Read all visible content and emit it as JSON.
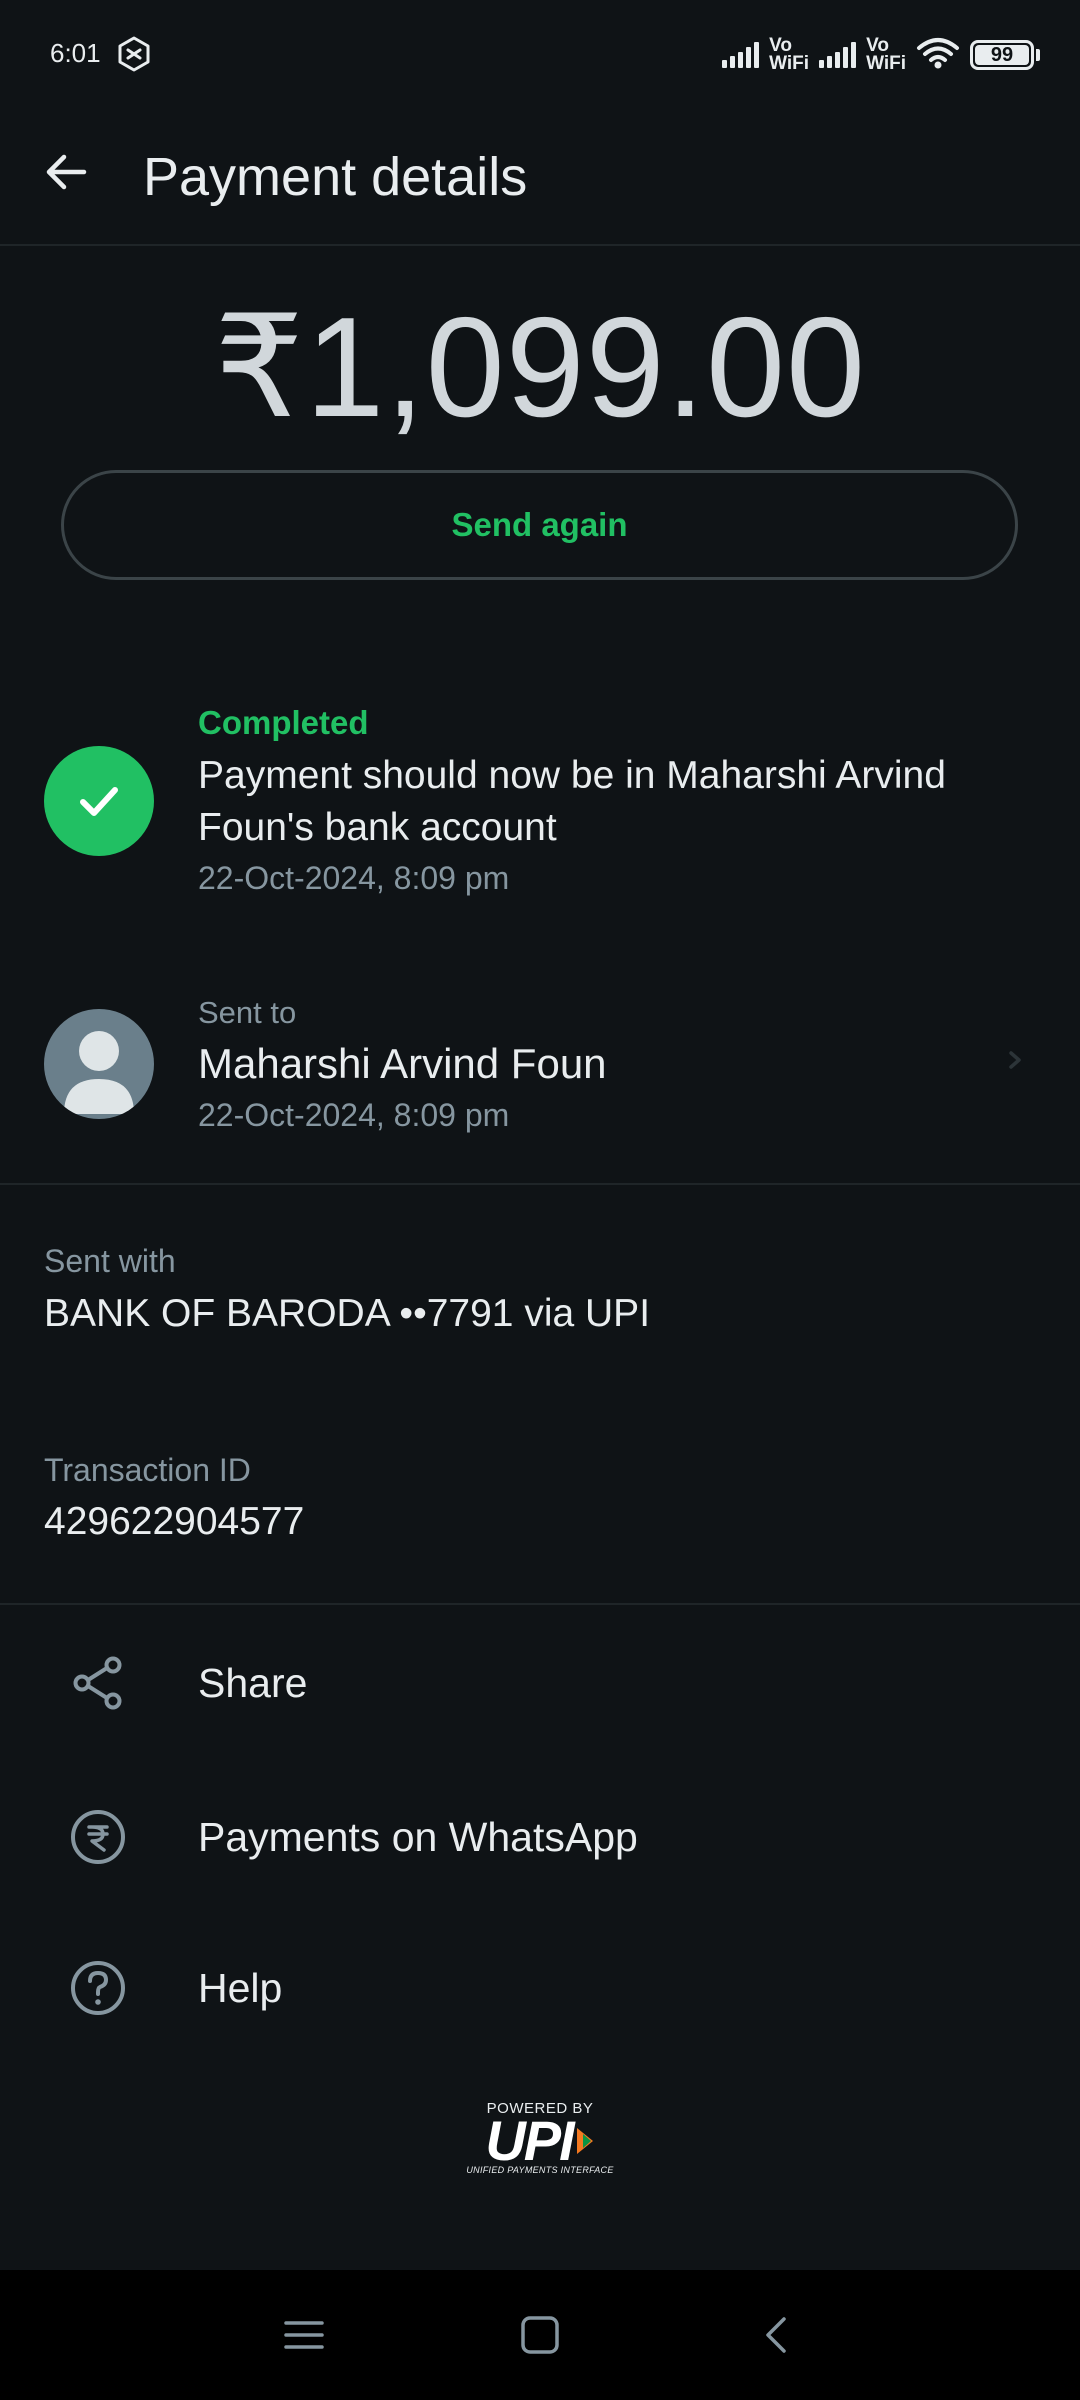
{
  "status_bar": {
    "time": "6:01",
    "vowifi_1": "Vo\nWiFi",
    "vowifi_2": "Vo\nWiFi",
    "battery": "99",
    "icons": [
      "shazam-icon",
      "signal-icon",
      "wifi-icon",
      "battery-icon"
    ]
  },
  "header": {
    "title": "Payment details",
    "back_icon": "arrow-left-icon"
  },
  "payment": {
    "amount": "₹1,099.00",
    "send_again_label": "Send again"
  },
  "status": {
    "label": "Completed",
    "message": "Payment should now be in Maharshi Arvind Foun's bank account",
    "timestamp": "22-Oct-2024, 8:09 pm",
    "icon": "check-icon"
  },
  "recipient": {
    "label": "Sent to",
    "name": "Maharshi Arvind Foun",
    "timestamp": "22-Oct-2024, 8:09 pm",
    "icon": "chevron-right-icon"
  },
  "sent_with": {
    "label": "Sent with",
    "value": "BANK OF BARODA ••7791 via UPI"
  },
  "transaction": {
    "label": "Transaction ID",
    "value": "429622904577"
  },
  "menu": [
    {
      "label": "Share",
      "icon": "share-icon"
    },
    {
      "label": "Payments on WhatsApp",
      "icon": "rupee-circle-icon"
    },
    {
      "label": "Help",
      "icon": "help-circle-icon"
    }
  ],
  "upi_logo": {
    "powered_by": "POWERED BY",
    "wordmark": "UPI",
    "tagline": "UNIFIED PAYMENTS INTERFACE"
  },
  "nav": {
    "icons": [
      "menu-icon",
      "home-icon",
      "back-icon"
    ]
  },
  "colors": {
    "background": "#0f1316",
    "accent_green": "#21c063",
    "text_primary": "#e9edef",
    "text_secondary": "#8696a0"
  }
}
